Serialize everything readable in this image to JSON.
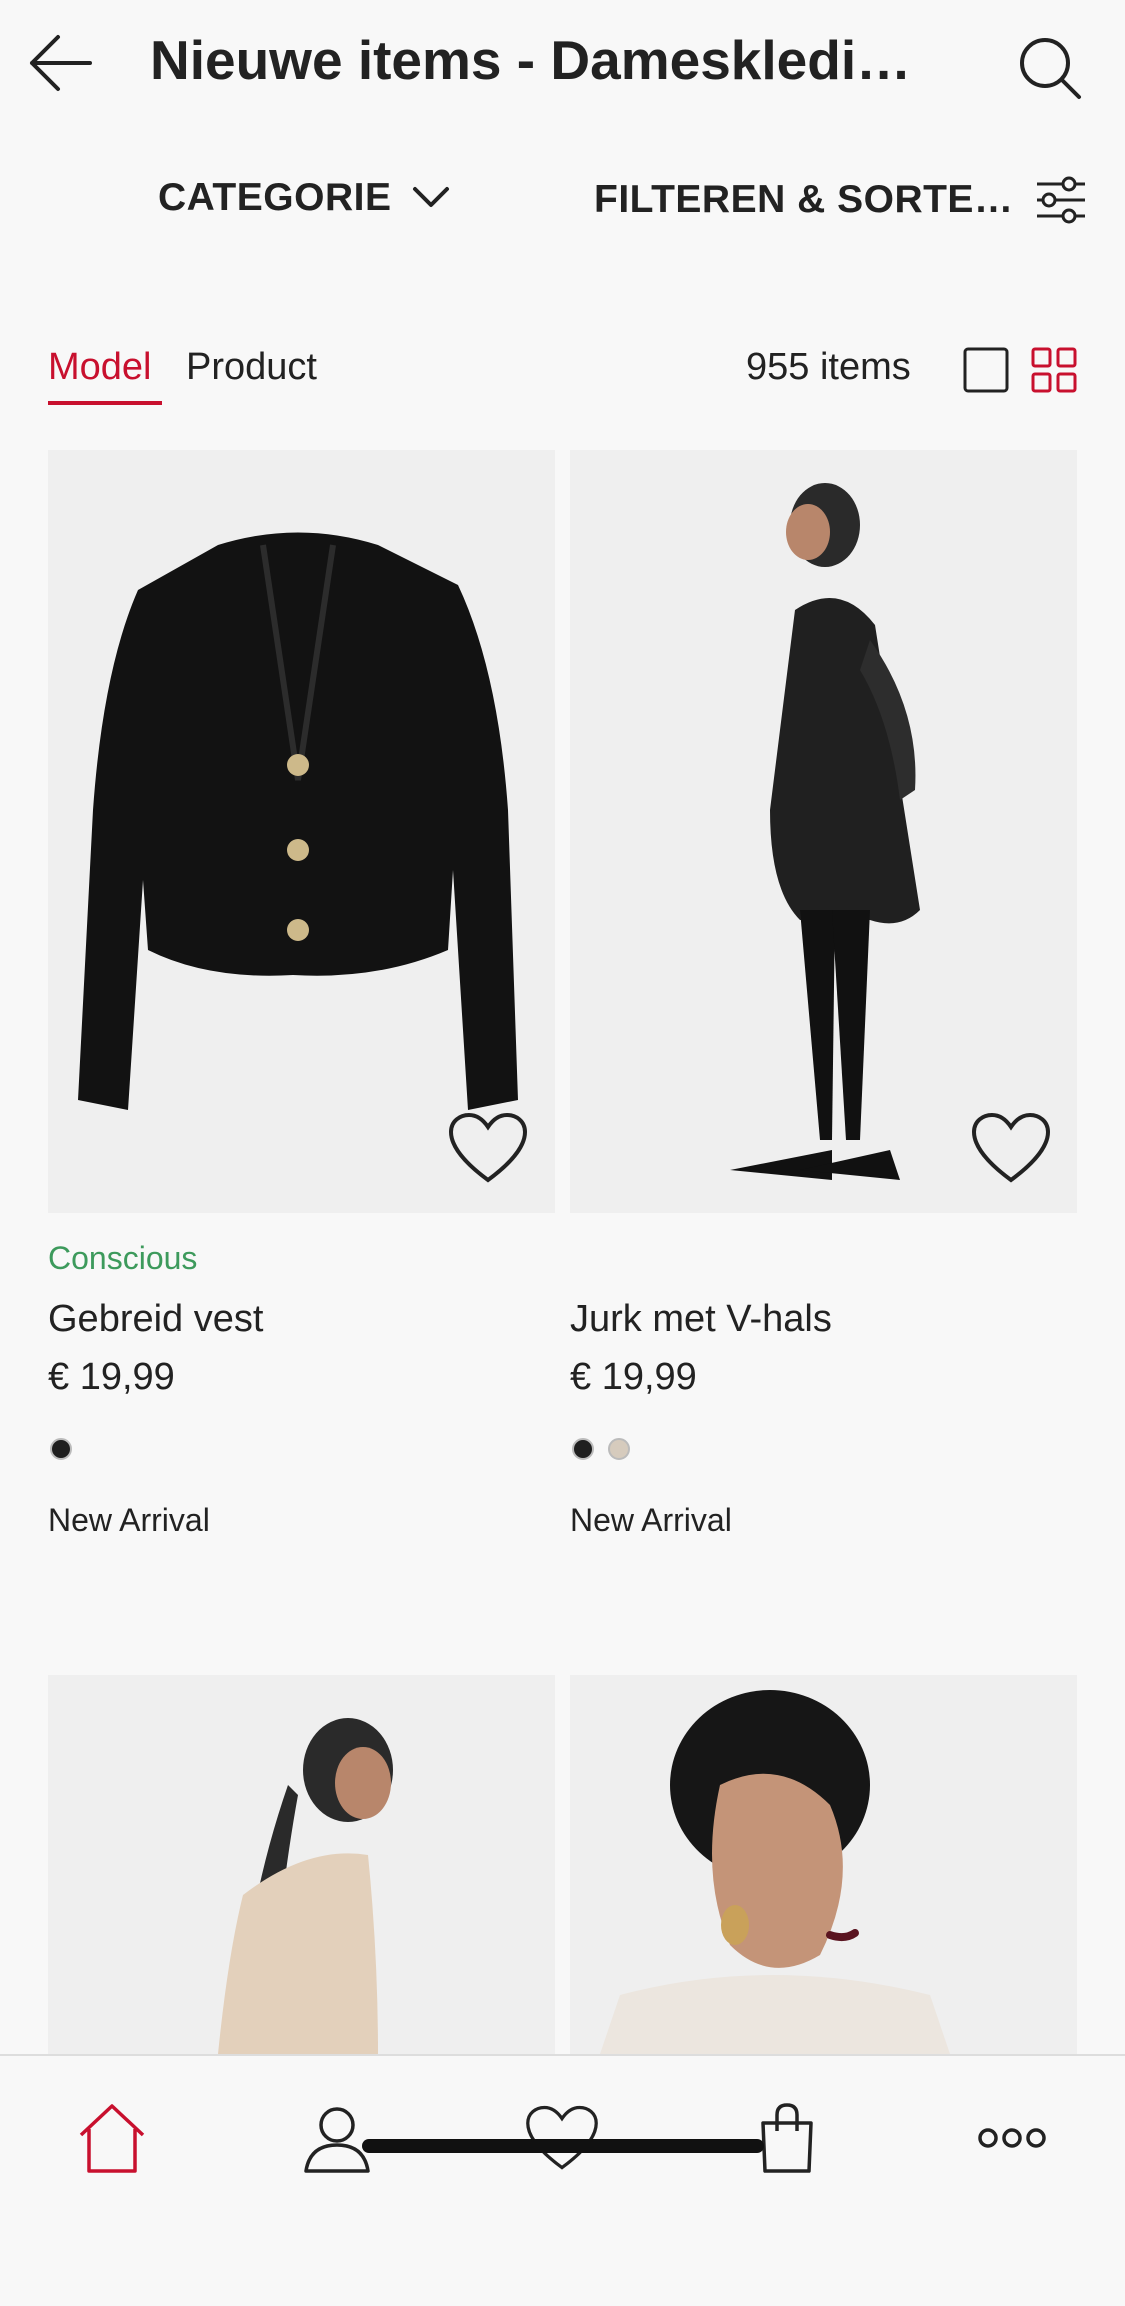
{
  "header": {
    "title": "Nieuwe items - Dameskledi…",
    "back_icon": "arrow-left-icon",
    "search_icon": "search-icon"
  },
  "filters": {
    "category_label": "CATEGORIE",
    "filter_sort_label": "FILTEREN & SORTE…"
  },
  "view_tabs": {
    "model": "Model",
    "product": "Product",
    "item_count": "955 items",
    "active_tab": "Model"
  },
  "colors": {
    "accent": "#c8102e",
    "conscious_green": "#3d9a5c"
  },
  "products": [
    {
      "badge": "Conscious",
      "name": "Gebreid vest",
      "price": "€ 19,99",
      "swatches": [
        "#1f1f1f"
      ],
      "tag": "New Arrival"
    },
    {
      "badge": "",
      "name": "Jurk met V-hals",
      "price": "€ 19,99",
      "swatches": [
        "#1f1f1f",
        "#d6cbbd"
      ],
      "tag": "New Arrival"
    }
  ],
  "bottom_nav": [
    "home-icon",
    "profile-icon",
    "favorites-heart-icon",
    "shopping-bag-icon",
    "more-dots-icon"
  ]
}
